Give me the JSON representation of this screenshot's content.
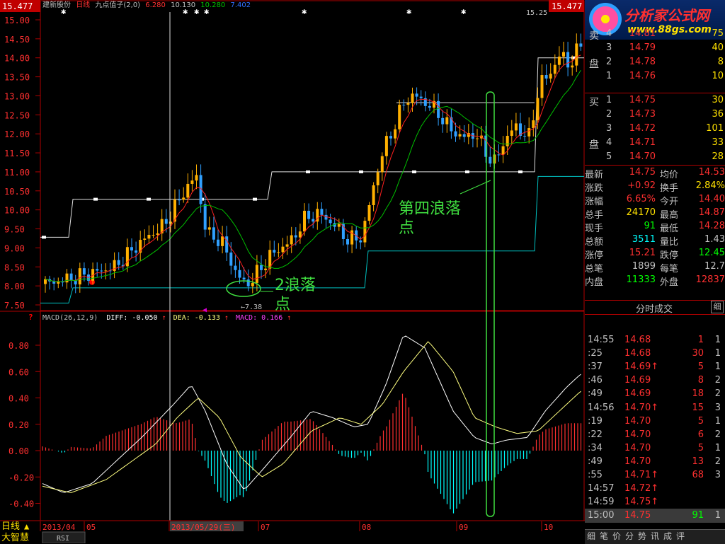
{
  "chart_header": {
    "price_left": "15.477",
    "price_right": "15.477",
    "stock": "建新股份",
    "period": "日线",
    "indicator": "九点值子(2,0)",
    "ind_val1": "6.280",
    "ind_val2": "10.130",
    "ind_val3": "10.280",
    "ind_val4": "7.402",
    "high_label": "15.25",
    "low_label": "←7.38"
  },
  "annotations": {
    "wave2_line1": "2浪落",
    "wave2_line2": "点",
    "wave4_line1": "第四浪落",
    "wave4_line2": "点"
  },
  "macd_header": {
    "title": "MACD(26,12,9)",
    "diff": "DIFF: -0.050",
    "dea": "DEA: -0.133",
    "macd": "MACD: 0.166"
  },
  "colors": {
    "up": "#ff3030",
    "down": "#00ffff",
    "price_up": "#ffb000",
    "price_down": "#30a0ff",
    "ma": "#ff2020",
    "ma2": "#00c000",
    "channel": "#e0e0e0",
    "channel2": "#00c0c0",
    "annot": "#40e040"
  },
  "chart_data": [
    {
      "type": "candlestick",
      "yticks": [
        15.0,
        14.5,
        14.0,
        13.5,
        13.0,
        12.5,
        12.0,
        11.5,
        11.0,
        10.5,
        10.0,
        9.5,
        9.0,
        8.5,
        8.0,
        7.5
      ],
      "ylim": [
        7.4,
        15.5
      ],
      "xlabels": [
        "2013/04",
        "05",
        "2013/05/29(三)",
        "07",
        "08",
        "09",
        "10"
      ]
    },
    {
      "type": "line",
      "title": "MACD(26,12,9)",
      "yticks": [
        0.8,
        0.6,
        0.4,
        0.2,
        0.0,
        -0.2,
        -0.4
      ],
      "ylim": [
        -0.48,
        0.88
      ]
    }
  ],
  "bottom_left": {
    "period": "日线",
    "tab": "RSI",
    "brand": "大智慧"
  },
  "orderbook": {
    "sell": [
      {
        "side": "卖",
        "lvl": "4",
        "price": "14.81",
        "vol": "75"
      },
      {
        "side": "",
        "lvl": "3",
        "price": "14.79",
        "vol": "40"
      },
      {
        "side": "盘",
        "lvl": "2",
        "price": "14.78",
        "vol": "8"
      },
      {
        "side": "",
        "lvl": "1",
        "price": "14.76",
        "vol": "10"
      }
    ],
    "buy": [
      {
        "side": "买",
        "lvl": "1",
        "price": "14.75",
        "vol": "30"
      },
      {
        "side": "",
        "lvl": "2",
        "price": "14.73",
        "vol": "36"
      },
      {
        "side": "",
        "lvl": "3",
        "price": "14.72",
        "vol": "101"
      },
      {
        "side": "盘",
        "lvl": "4",
        "price": "14.71",
        "vol": "33"
      },
      {
        "side": "",
        "lvl": "5",
        "price": "14.70",
        "vol": "28"
      }
    ]
  },
  "quote": [
    {
      "k1": "最新",
      "v1": "14.75",
      "c1": "#ff3030",
      "k2": "均价",
      "v2": "14.53",
      "c2": "#ff3030"
    },
    {
      "k1": "涨跌",
      "v1": "+0.92",
      "c1": "#ff3030",
      "k2": "换手",
      "v2": "2.84%",
      "c2": "#ffe100"
    },
    {
      "k1": "涨幅",
      "v1": "6.65%",
      "c1": "#ff3030",
      "k2": "今开",
      "v2": "14.40",
      "c2": "#ff3030"
    },
    {
      "k1": "总手",
      "v1": "24170",
      "c1": "#ffe100",
      "k2": "最高",
      "v2": "14.87",
      "c2": "#ff3030"
    },
    {
      "k1": "现手",
      "v1": "91",
      "c1": "#00ff00",
      "k2": "最低",
      "v2": "14.28",
      "c2": "#ff3030"
    },
    {
      "k1": "总额",
      "v1": "3511",
      "c1": "#00ffff",
      "k2": "量比",
      "v2": "1.43",
      "c2": "#c0c0c0"
    },
    {
      "k1": "涨停",
      "v1": "15.21",
      "c1": "#ff3030",
      "k2": "跌停",
      "v2": "12.45",
      "c2": "#00ff00"
    },
    {
      "k1": "总笔",
      "v1": "1899",
      "c1": "#c0c0c0",
      "k2": "每笔",
      "v2": "12.7",
      "c2": "#c0c0c0"
    },
    {
      "k1": "内盘",
      "v1": "11333",
      "c1": "#00ff00",
      "k2": "外盘",
      "v2": "12837",
      "c2": "#ff3030"
    }
  ],
  "ticks_header": {
    "title": "分时成交",
    "btn": "细"
  },
  "ticks": [
    {
      "t": "14:55",
      "p": "14.68",
      "a": "",
      "v": "1",
      "vc": "#ff3030",
      "n": "1"
    },
    {
      "t": ":25",
      "p": "14.68",
      "a": "",
      "v": "30",
      "vc": "#ff3030",
      "n": "1"
    },
    {
      "t": ":37",
      "p": "14.69",
      "a": "↑",
      "v": "5",
      "vc": "#ff3030",
      "n": "1"
    },
    {
      "t": ":46",
      "p": "14.69",
      "a": "",
      "v": "8",
      "vc": "#ff3030",
      "n": "2"
    },
    {
      "t": ":49",
      "p": "14.69",
      "a": "",
      "v": "18",
      "vc": "#ff3030",
      "n": "2"
    },
    {
      "t": "14:56",
      "p": "14.70",
      "a": "↑",
      "v": "15",
      "vc": "#ff3030",
      "n": "3"
    },
    {
      "t": ":19",
      "p": "14.70",
      "a": "",
      "v": "5",
      "vc": "#ff3030",
      "n": "1"
    },
    {
      "t": ":22",
      "p": "14.70",
      "a": "",
      "v": "6",
      "vc": "#ff3030",
      "n": "2"
    },
    {
      "t": ":34",
      "p": "14.70",
      "a": "",
      "v": "5",
      "vc": "#ff3030",
      "n": "1"
    },
    {
      "t": ":49",
      "p": "14.70",
      "a": "",
      "v": "13",
      "vc": "#ff3030",
      "n": "2"
    },
    {
      "t": ":55",
      "p": "14.71",
      "a": "↑",
      "v": "68",
      "vc": "#ff3030",
      "n": "3"
    },
    {
      "t": "14:57",
      "p": "14.72",
      "a": "↑",
      "v": "",
      "vc": "#ff3030",
      "n": ""
    },
    {
      "t": "14:59",
      "p": "14.75",
      "a": "↑",
      "v": "",
      "vc": "#ff3030",
      "n": ""
    },
    {
      "t": "15:00",
      "p": "14.75",
      "a": "",
      "v": "91",
      "vc": "#00ff00",
      "n": "1"
    }
  ],
  "bottom_tabs": [
    "细",
    "笔",
    "价",
    "分",
    "势",
    "讯",
    "成",
    "评"
  ],
  "logo": {
    "name": "分析家公式网",
    "url": "www.88gs.com"
  }
}
